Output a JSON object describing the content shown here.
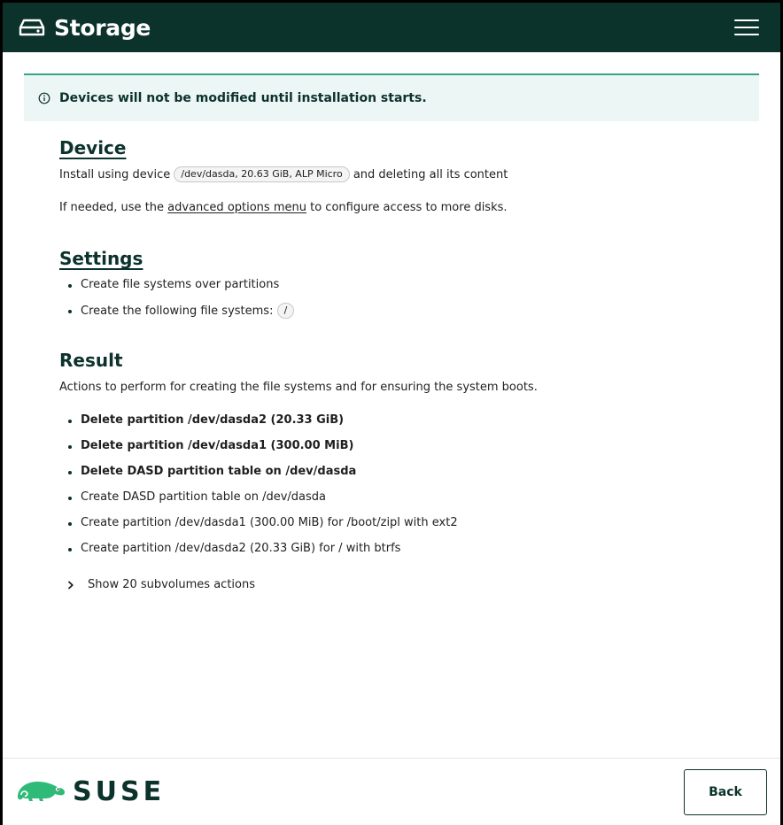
{
  "header": {
    "title": "Storage",
    "icon": "hard-drive-icon",
    "menu_icon": "hamburger-menu-icon"
  },
  "alert": {
    "icon": "info-icon",
    "text": "Devices will not be modified until installation starts."
  },
  "device": {
    "title": "Device",
    "line1_before": "Install using device",
    "device_chip": "/dev/dasda, 20.63 GiB, ALP Micro",
    "line1_after": "and deleting all its content",
    "line2_before": "If needed, use the",
    "line2_link": "advanced options menu",
    "line2_after": "to configure access to more disks."
  },
  "settings": {
    "title": "Settings",
    "items": [
      "Create file systems over partitions",
      "Create the following file systems:"
    ],
    "fs_chip": "/"
  },
  "result": {
    "title": "Result",
    "description": "Actions to perform for creating the file systems and for ensuring the system boots.",
    "actions": [
      {
        "text": "Delete partition /dev/dasda2 (20.33 GiB)",
        "bold": true
      },
      {
        "text": "Delete partition /dev/dasda1 (300.00 MiB)",
        "bold": true
      },
      {
        "text": "Delete DASD partition table on /dev/dasda",
        "bold": true
      },
      {
        "text": "Create DASD partition table on /dev/dasda",
        "bold": false
      },
      {
        "text": "Create partition /dev/dasda1 (300.00 MiB) for /boot/zipl with ext2",
        "bold": false
      },
      {
        "text": "Create partition /dev/dasda2 (20.33 GiB) for / with btrfs",
        "bold": false
      }
    ],
    "expander_label": "Show 20 subvolumes actions"
  },
  "footer": {
    "logo_text": "SUSE",
    "back_label": "Back"
  },
  "colors": {
    "header_bg": "#0c322c",
    "accent": "#30a58a",
    "alert_bg": "#ecf6f4"
  }
}
